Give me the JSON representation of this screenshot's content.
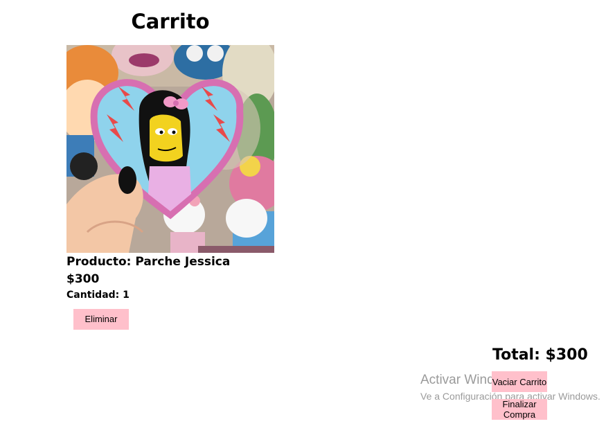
{
  "page": {
    "title": "Carrito"
  },
  "cart": {
    "item": {
      "name": "Producto: Parche Jessica",
      "price": "$300",
      "quantity": "Cantidad: 1",
      "remove_label": "Eliminar"
    },
    "total": "Total: $300",
    "empty_label": "Vaciar Carrito",
    "finish_label": "Finalizar Compra"
  },
  "watermark": {
    "title": "Activar Windows",
    "subtitle": "Ve a Configuración para activar Windows."
  },
  "colors": {
    "button_bg": "#ffc0cb",
    "text": "#000000"
  }
}
